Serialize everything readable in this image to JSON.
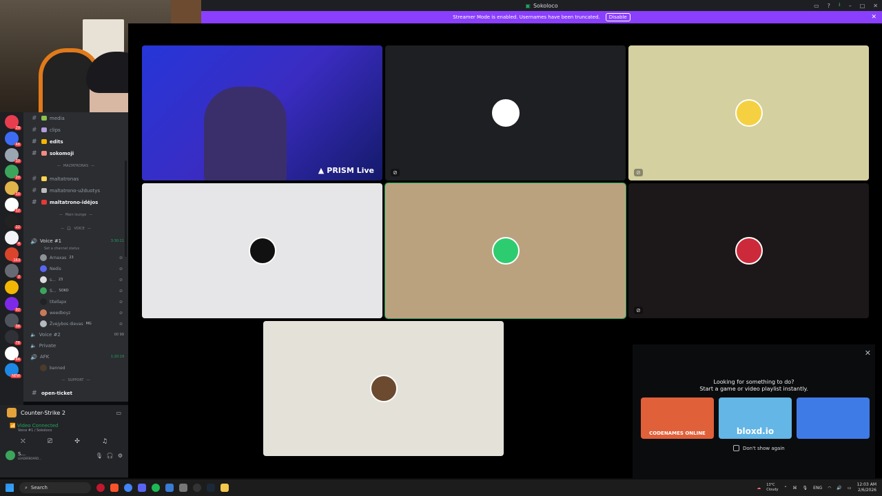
{
  "window": {
    "title": "Sokoloco",
    "icons": [
      "screen-share-icon",
      "help-icon",
      "download-icon",
      "minimize-icon",
      "maximize-icon",
      "close-icon"
    ]
  },
  "banner": {
    "text": "Streamer Mode is enabled. Usernames have been truncated.",
    "button": "Disable"
  },
  "rail": {
    "servers": [
      {
        "color": "#e83d4f",
        "badge": "29"
      },
      {
        "color": "#3d6cf3",
        "badge": "48"
      },
      {
        "color": "#9aa6b2",
        "badge": "10"
      },
      {
        "color": "#3ba55c",
        "badge": "20"
      },
      {
        "color": "#e0b44a",
        "badge": "10"
      },
      {
        "color": "#ffffff",
        "badge": "12"
      },
      {
        "color": "#222222",
        "badge": "22"
      },
      {
        "color": "#f2f3f5",
        "badge": "4"
      },
      {
        "color": "#d9442b",
        "badge": "163"
      },
      {
        "color": "#666b73",
        "badge": "2"
      },
      {
        "color": "#f2b705",
        "badge": ""
      },
      {
        "color": "#7d2ae8",
        "badge": "92"
      },
      {
        "color": "#4f545c",
        "badge": "38"
      },
      {
        "color": "#2f3136",
        "badge": "78"
      },
      {
        "color": "#ffffff",
        "badge": "44"
      },
      {
        "color": "#1e88e5",
        "badge": "NEW"
      }
    ]
  },
  "channels": {
    "text": [
      {
        "name": "media",
        "emoji_color": "#8bc34a",
        "active": false
      },
      {
        "name": "clips",
        "emoji_color": "#b39ddb",
        "active": false
      },
      {
        "name": "edits",
        "emoji_color": "#f4b400",
        "active": true
      },
      {
        "name": "sokomoji",
        "emoji_color": "#f28b82",
        "active": true
      }
    ],
    "category_1": "MALTATRONAS",
    "text2": [
      {
        "name": "maltatronas",
        "emoji_color": "#ffd54f",
        "active": false
      },
      {
        "name": "maltatrono-užduotys",
        "emoji_color": "#bdbdbd",
        "active": false
      },
      {
        "name": "maltatrono-idėjos",
        "emoji_color": "#e53935",
        "active": true
      }
    ],
    "category_2": "Main lounge",
    "category_3": "VOICE",
    "voice1": {
      "name": "Voice #1",
      "time": "3:30:11",
      "status": "Set a channel status"
    },
    "voice_users": [
      {
        "name": "Arnaxas",
        "tag": "23",
        "color": "#8e9297"
      },
      {
        "name": "Nedis",
        "tag": "",
        "color": "#5865f2"
      },
      {
        "name": "s...",
        "tag": "23",
        "color": "#dddddd"
      },
      {
        "name": "S...",
        "tag": "SOKO",
        "color": "#3ba55c"
      },
      {
        "name": "titellapx",
        "tag": "",
        "color": "#202225"
      },
      {
        "name": "weedboyz",
        "tag": "",
        "color": "#c97a5a"
      },
      {
        "name": "Žvejybos dievas",
        "tag": "MG",
        "color": "#b5bac1"
      }
    ],
    "voice2": {
      "name": "Voice #2",
      "counts": "00  99"
    },
    "private": "Private",
    "afk": {
      "name": "AFK",
      "time": "1:20:19"
    },
    "afk_user": "banned",
    "category_4": "SUPPORT",
    "open_ticket": "open-ticket"
  },
  "panel": {
    "game": "Counter-Strike 2",
    "vc_status": "Video Connected",
    "vc_sub": "Voice #1 / Sokoloco",
    "me_name": "S...",
    "me_sub": "LEADERBOARD..."
  },
  "stage": {
    "prism": "PRISM Live",
    "tiles": [
      {
        "bg": "#1e1f22",
        "avatar": "#ffffff"
      },
      {
        "bg": "#d4d0a0",
        "avatar": "#f5d142"
      },
      {
        "bg": "#e6e6e8",
        "avatar": "#111111"
      },
      {
        "bg": "#bba27f",
        "avatar": "#2ecc71"
      },
      {
        "bg": "#1c1718",
        "avatar": "#cc2a3a"
      },
      {
        "bg": "#e3e1d8",
        "avatar": "#6b4a2f"
      }
    ]
  },
  "activity": {
    "line1": "Looking for something to do?",
    "line2": "Start a game or video playlist instantly.",
    "cards": [
      {
        "label": "CODENAMES ONLINE",
        "bg": "#e0603a"
      },
      {
        "label": "bloxd.io",
        "bg": "#63b6e6"
      },
      {
        "label": "",
        "bg": "#3f7be6"
      }
    ],
    "dont_show": "Don't show again"
  },
  "taskbar": {
    "search": "Search",
    "weather_temp": "13°C",
    "weather_text": "Cloudy",
    "lang": "ENG",
    "time": "12:03 AM",
    "date": "2/6/2026"
  }
}
